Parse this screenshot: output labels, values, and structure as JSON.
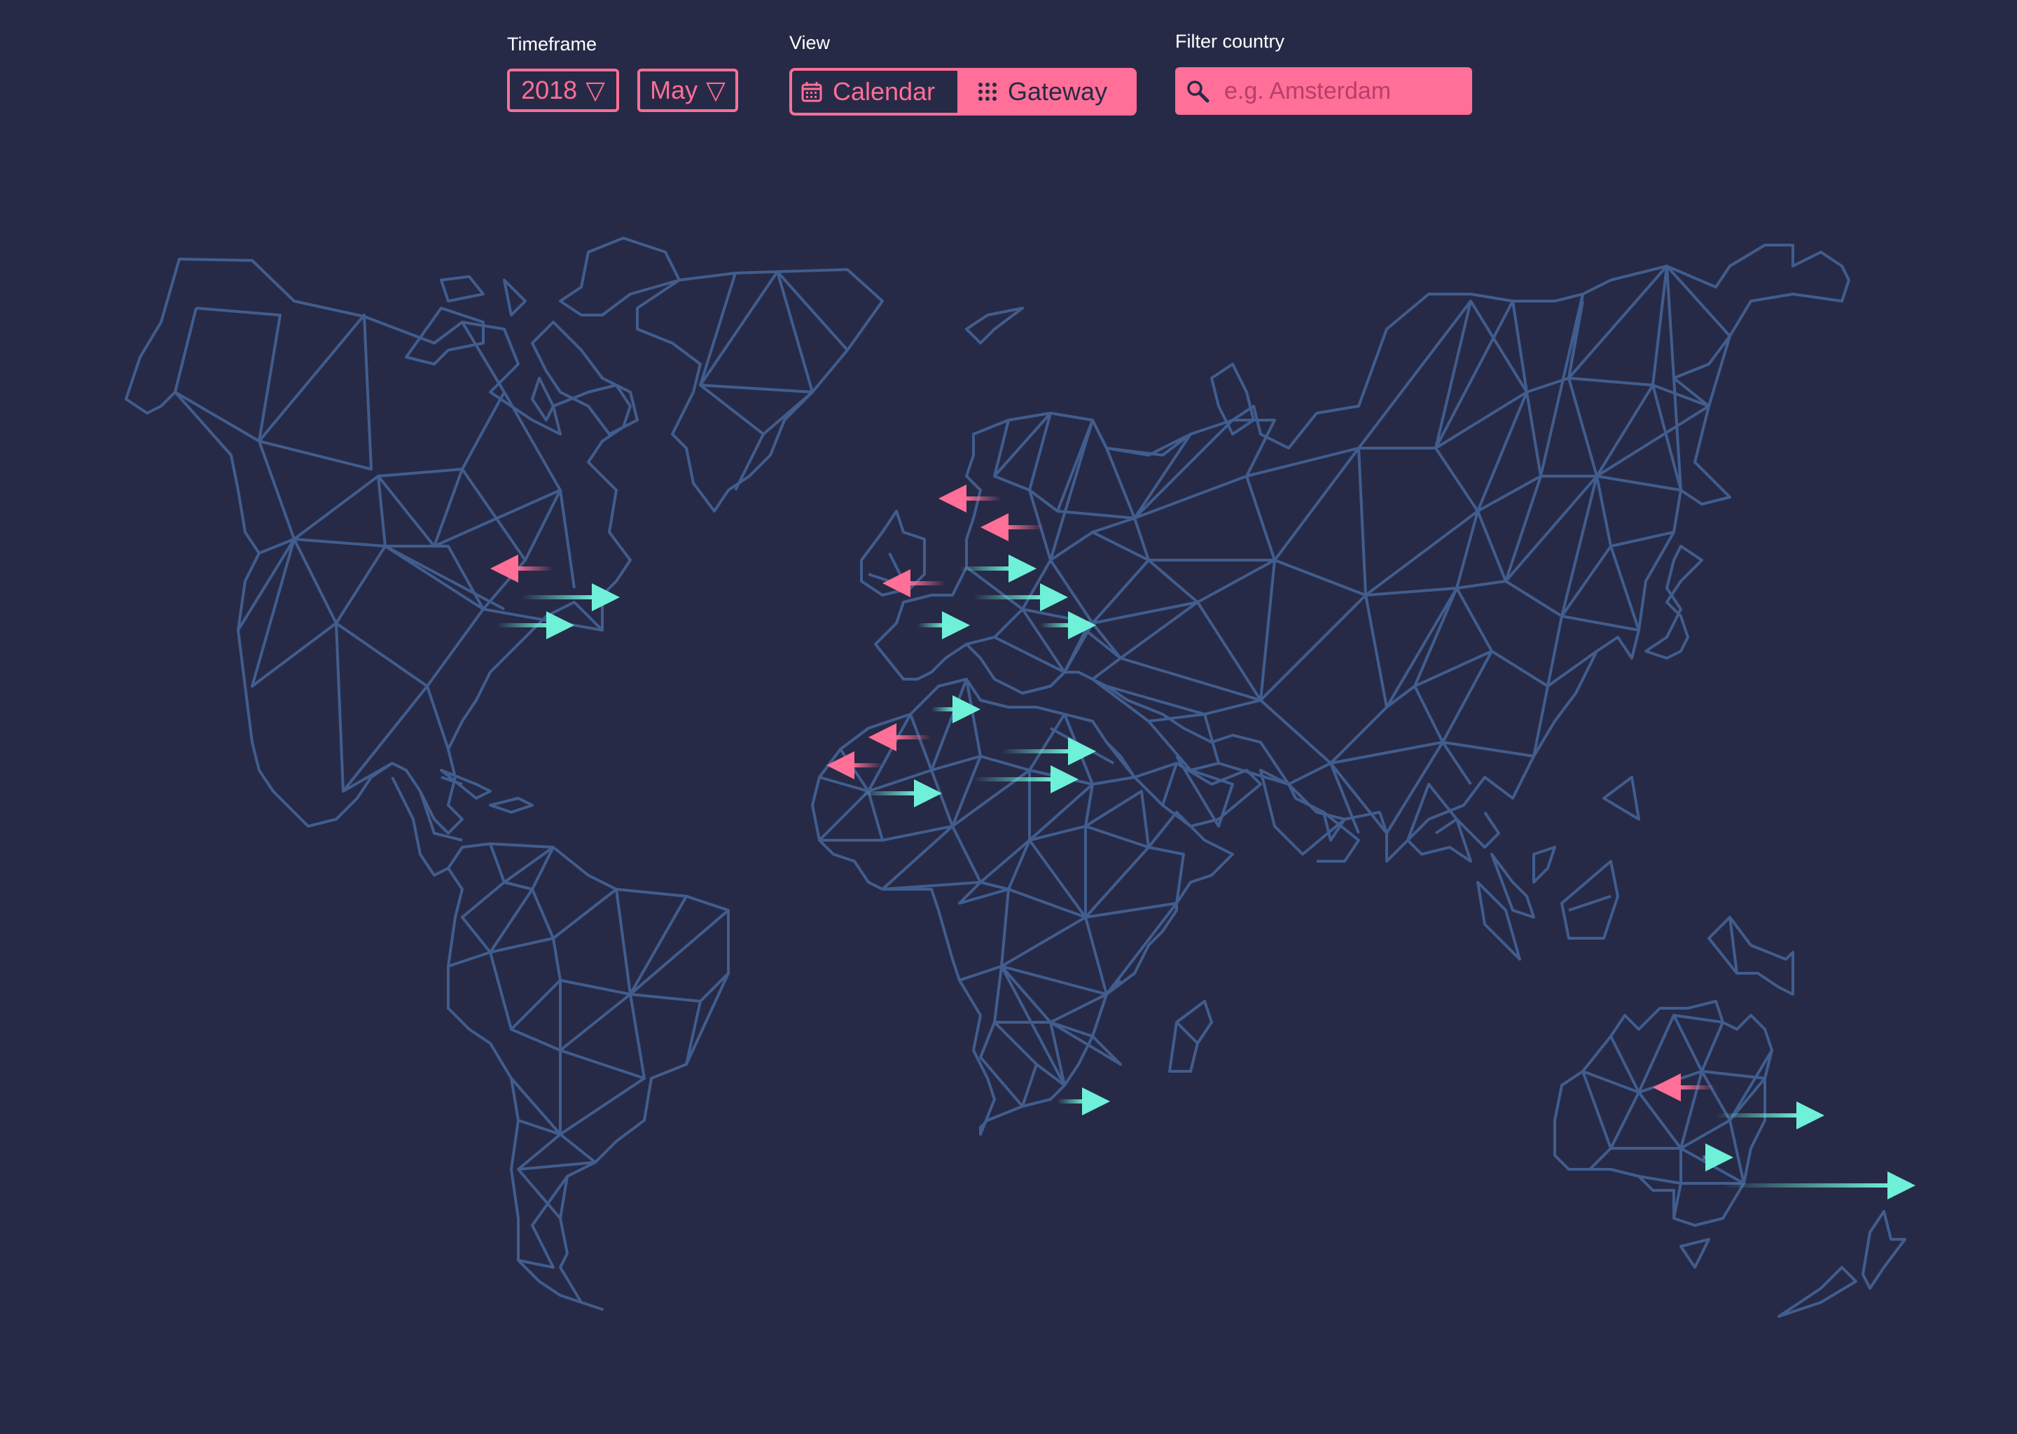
{
  "timeframe": {
    "label": "Timeframe",
    "year": "2018",
    "month": "May",
    "caret": "▽"
  },
  "view": {
    "label": "View",
    "options": [
      "Calendar",
      "Gateway"
    ],
    "selected": "Gateway",
    "icons": [
      "calendar-icon",
      "grid-icon"
    ]
  },
  "filter": {
    "label": "Filter country",
    "placeholder": "e.g. Amsterdam",
    "icon": "search-icon"
  },
  "colors": {
    "background": "#272a46",
    "accent": "#ff6f97",
    "map_stroke": "#405d8e",
    "inbound": "#ff6f97",
    "outbound": "#6ff0d8"
  },
  "map": {
    "arrows": [
      {
        "direction": "in",
        "region": "north-america"
      },
      {
        "direction": "out",
        "region": "north-america"
      },
      {
        "direction": "out",
        "region": "north-america"
      },
      {
        "direction": "in",
        "region": "europe"
      },
      {
        "direction": "in",
        "region": "europe"
      },
      {
        "direction": "out",
        "region": "europe"
      },
      {
        "direction": "in",
        "region": "europe"
      },
      {
        "direction": "out",
        "region": "europe"
      },
      {
        "direction": "out",
        "region": "europe"
      },
      {
        "direction": "out",
        "region": "europe"
      },
      {
        "direction": "out",
        "region": "africa"
      },
      {
        "direction": "in",
        "region": "africa"
      },
      {
        "direction": "out",
        "region": "africa"
      },
      {
        "direction": "in",
        "region": "africa"
      },
      {
        "direction": "out",
        "region": "africa"
      },
      {
        "direction": "out",
        "region": "africa"
      },
      {
        "direction": "out",
        "region": "southern-africa"
      },
      {
        "direction": "in",
        "region": "australia"
      },
      {
        "direction": "out",
        "region": "australia"
      },
      {
        "direction": "out",
        "region": "australia"
      },
      {
        "direction": "out",
        "region": "australia"
      }
    ]
  }
}
